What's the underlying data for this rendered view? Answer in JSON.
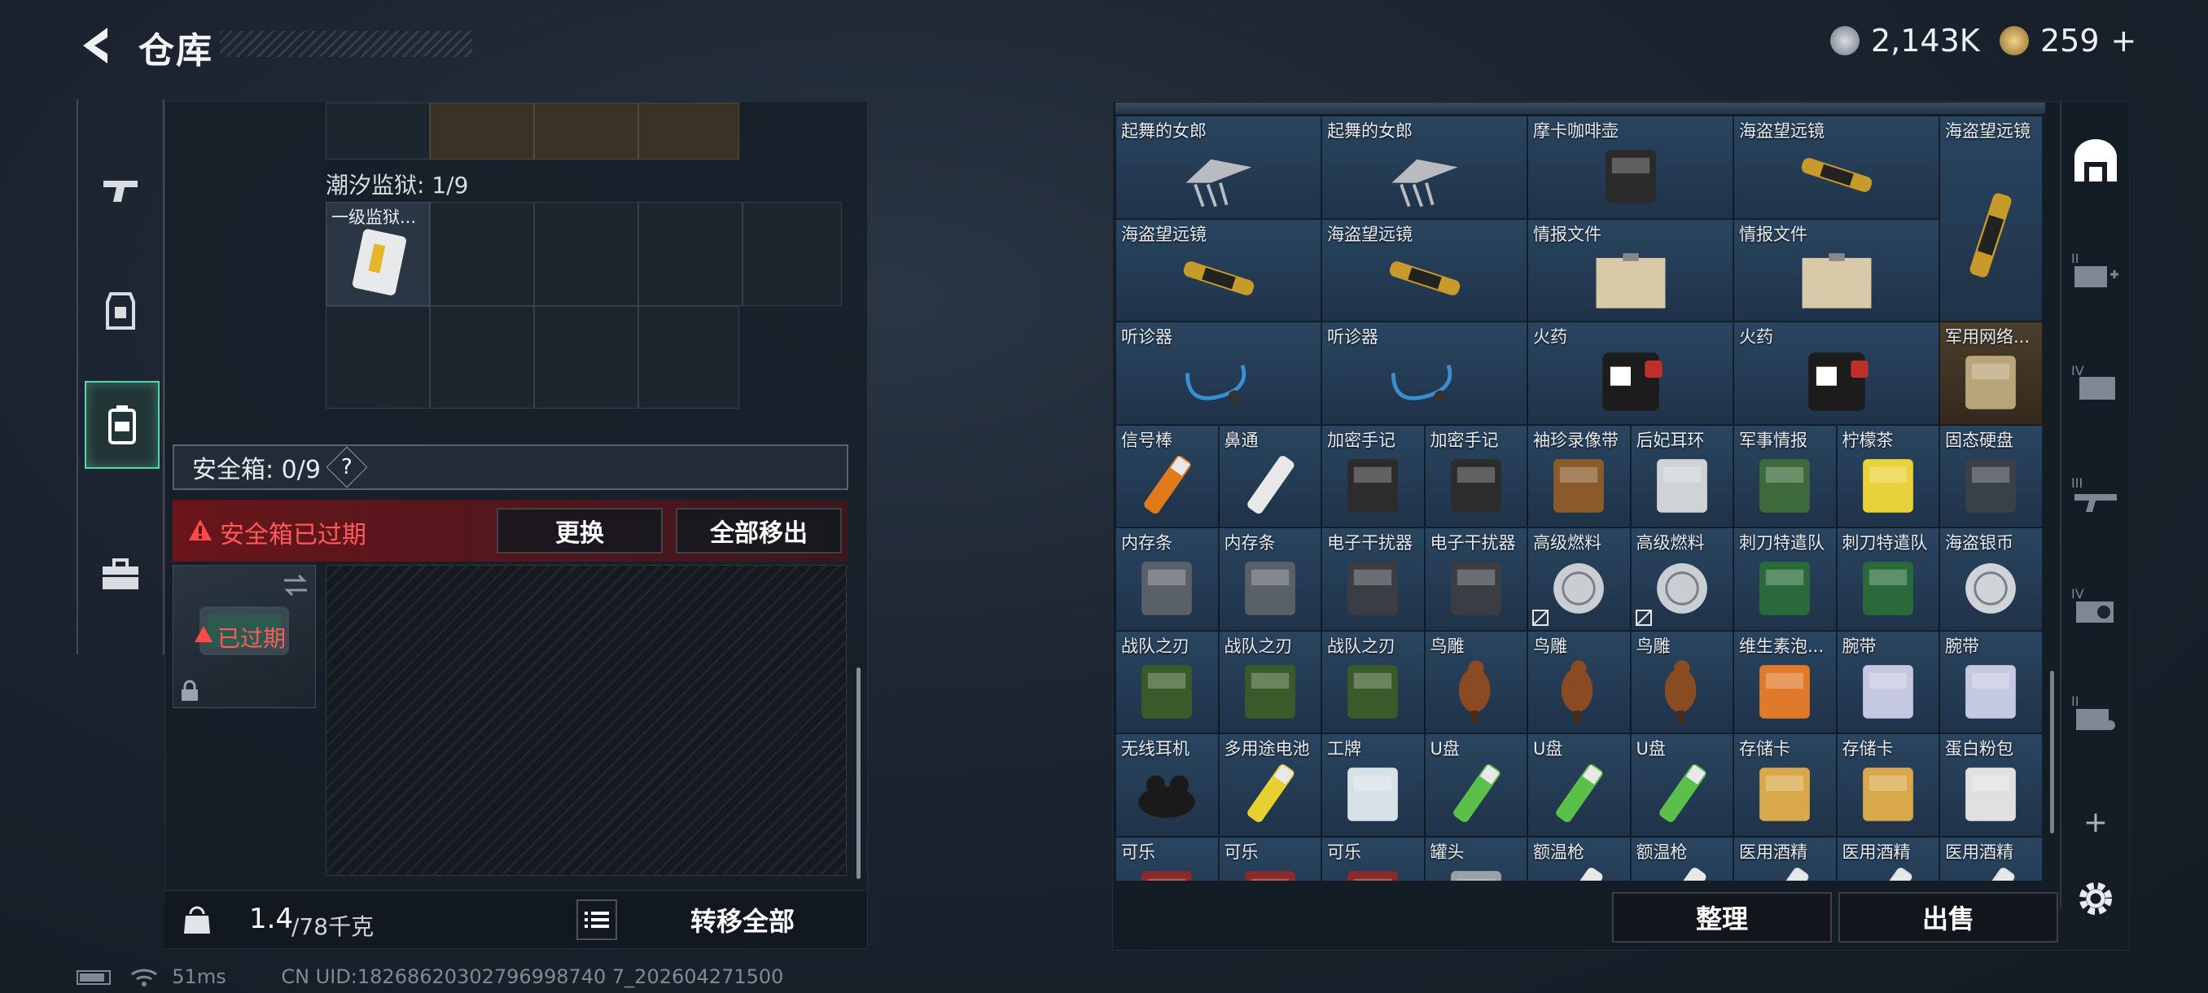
{
  "header": {
    "title": "仓库",
    "currency_1": "2,143K",
    "currency_2": "259",
    "plus": "+"
  },
  "left": {
    "tabs": [
      "gun-icon",
      "armor-icon",
      "backpack-icon",
      "case-icon"
    ],
    "prison_label": "潮汐监狱: 1/9",
    "prison_item": "一级监狱...",
    "safebox_label": "安全箱: 0/9",
    "help": "?",
    "expired_warning": "安全箱已过期",
    "replace_btn": "更换",
    "remove_all_btn": "全部移出",
    "expired_tag": "已过期",
    "weight_value": "1.4",
    "weight_max": "/78千克",
    "transfer_all": "转移全部"
  },
  "right": {
    "items": [
      {
        "label": "起舞的女郎",
        "icon": "dancer-icon"
      },
      {
        "label": "起舞的女郎",
        "icon": "dancer-icon"
      },
      {
        "label": "摩卡咖啡壶",
        "icon": "coffee-pot-icon"
      },
      {
        "label": "海盗望远镜",
        "icon": "telescope-icon"
      },
      {
        "label": "海盗望远镜",
        "icon": "telescope-vertical-icon"
      },
      {
        "label": "海盗望远镜",
        "icon": "telescope-icon"
      },
      {
        "label": "海盗望远镜",
        "icon": "telescope-icon"
      },
      {
        "label": "情报文件",
        "icon": "document-icon"
      },
      {
        "label": "情报文件",
        "icon": "document-icon"
      },
      {
        "label": "听诊器",
        "icon": "stethoscope-icon"
      },
      {
        "label": "听诊器",
        "icon": "stethoscope-icon"
      },
      {
        "label": "火药",
        "icon": "gunpowder-icon"
      },
      {
        "label": "火药",
        "icon": "gunpowder-icon"
      },
      {
        "label": "军用网络...",
        "icon": "network-icon"
      },
      {
        "label": "信号棒",
        "icon": "flare-icon"
      },
      {
        "label": "鼻通",
        "icon": "inhaler-icon"
      },
      {
        "label": "加密手记",
        "icon": "notebook-icon"
      },
      {
        "label": "加密手记",
        "icon": "notebook-icon"
      },
      {
        "label": "袖珍录像带",
        "icon": "tape-icon"
      },
      {
        "label": "后妃耳环",
        "icon": "earring-icon"
      },
      {
        "label": "军事情报",
        "icon": "chip-icon"
      },
      {
        "label": "柠檬茶",
        "icon": "can-icon"
      },
      {
        "label": "固态硬盘",
        "icon": "ssd-icon"
      },
      {
        "label": "内存条",
        "icon": "ram-icon"
      },
      {
        "label": "内存条",
        "icon": "ram-icon"
      },
      {
        "label": "电子干扰器",
        "icon": "jammer-icon"
      },
      {
        "label": "电子干扰器",
        "icon": "jammer-icon"
      },
      {
        "label": "高级燃料",
        "icon": "fuel-icon"
      },
      {
        "label": "高级燃料",
        "icon": "fuel-icon"
      },
      {
        "label": "刺刀特遣队",
        "icon": "book-icon"
      },
      {
        "label": "刺刀特遣队",
        "icon": "book-icon"
      },
      {
        "label": "海盗银币",
        "icon": "coin-icon"
      },
      {
        "label": "战队之刃",
        "icon": "game-box-icon"
      },
      {
        "label": "战队之刃",
        "icon": "game-box-icon"
      },
      {
        "label": "战队之刃",
        "icon": "game-box-icon"
      },
      {
        "label": "鸟雕",
        "icon": "bird-icon"
      },
      {
        "label": "鸟雕",
        "icon": "bird-icon"
      },
      {
        "label": "鸟雕",
        "icon": "bird-icon"
      },
      {
        "label": "维生素泡...",
        "icon": "vitamin-icon"
      },
      {
        "label": "腕带",
        "icon": "wristband-icon"
      },
      {
        "label": "腕带",
        "icon": "wristband-icon"
      },
      {
        "label": "无线耳机",
        "icon": "earbuds-icon"
      },
      {
        "label": "多用途电池",
        "icon": "battery-icon"
      },
      {
        "label": "工牌",
        "icon": "badge-icon"
      },
      {
        "label": "U盘",
        "icon": "usb-icon"
      },
      {
        "label": "U盘",
        "icon": "usb-icon"
      },
      {
        "label": "U盘",
        "icon": "usb-icon"
      },
      {
        "label": "存储卡",
        "icon": "sdcard-icon"
      },
      {
        "label": "存储卡",
        "icon": "sdcard-icon"
      },
      {
        "label": "蛋白粉包",
        "icon": "protein-icon"
      },
      {
        "label": "可乐",
        "icon": "cola-icon"
      },
      {
        "label": "可乐",
        "icon": "cola-icon"
      },
      {
        "label": "可乐",
        "icon": "cola-icon"
      },
      {
        "label": "罐头",
        "icon": "canned-icon"
      },
      {
        "label": "额温枪",
        "icon": "thermometer-icon"
      },
      {
        "label": "额温枪",
        "icon": "thermometer-icon"
      },
      {
        "label": "医用酒精",
        "icon": "alcohol-icon"
      },
      {
        "label": "医用酒精",
        "icon": "alcohol-icon"
      },
      {
        "label": "医用酒精",
        "icon": "alcohol-icon"
      }
    ],
    "sort_btn": "整理",
    "sell_btn": "出售",
    "sidebar": [
      "storage-icon",
      "tab-II-add-icon",
      "tab-IV-folder-icon",
      "tab-III-gun-icon",
      "tab-IV-gear-icon",
      "tab-II-backpack-icon",
      "add-icon",
      "settings-icon"
    ],
    "add": "+"
  },
  "status": {
    "ping": "51ms",
    "uid": "CN UID:18268620302796998740 7_202604271500"
  },
  "colors": {
    "accent": "#5ad3a6",
    "warning": "#e23b3b",
    "cell": "#24405a",
    "gold_cell": "#4a3e2c"
  }
}
